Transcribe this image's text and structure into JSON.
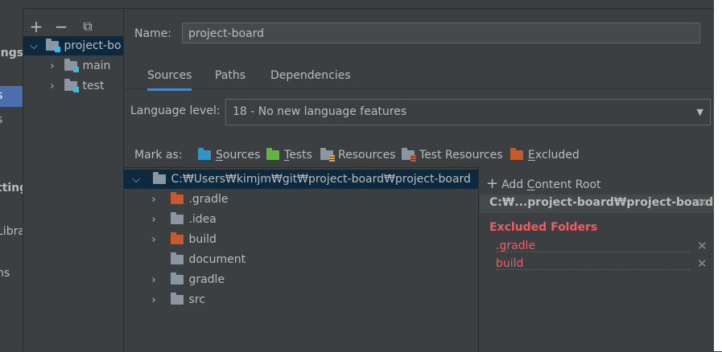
{
  "sidebar_fragments": [
    {
      "text": "ings",
      "bold": true
    },
    {
      "text": "s",
      "bold": false
    },
    {
      "text": "s",
      "bold": false
    },
    {
      "text": "tting",
      "bold": true
    },
    {
      "text": "Libra",
      "bold": false
    },
    {
      "text": "ns",
      "bold": false
    }
  ],
  "toolbar": {
    "add_icon": "+",
    "remove_icon": "−",
    "copy_icon": "⧉"
  },
  "module_tree": {
    "root": {
      "label": "project-bo",
      "icon": "module-folder-icon"
    },
    "children": [
      {
        "label": "main",
        "icon": "module-folder-icon"
      },
      {
        "label": "test",
        "icon": "module-folder-icon"
      }
    ]
  },
  "name_field": {
    "label": "Name:",
    "value": "project-board"
  },
  "tabs": [
    {
      "label": "Sources",
      "active": true
    },
    {
      "label": "Paths",
      "active": false
    },
    {
      "label": "Dependencies",
      "active": false
    }
  ],
  "language_level": {
    "label": "Language level:",
    "value": "18 - No new language features"
  },
  "mark_as": {
    "label": "Mark as:",
    "items": [
      {
        "label": "Sources",
        "mnemonic": "S",
        "rest": "ources",
        "icon": "sources-folder-icon",
        "color": "#3592c4"
      },
      {
        "label": "Tests",
        "mnemonic": "T",
        "rest": "ests",
        "icon": "tests-folder-icon",
        "color": "#62b543"
      },
      {
        "label": "Resources",
        "mnemonic": "",
        "rest": "Resources",
        "icon": "resources-folder-icon",
        "color": "#8c96a0"
      },
      {
        "label": "Test Resources",
        "mnemonic": "",
        "rest": "Test Resources",
        "icon": "test-resources-folder-icon",
        "color": "#8c96a0"
      },
      {
        "label": "Excluded",
        "mnemonic": "E",
        "rest": "xcluded",
        "icon": "excluded-folder-icon",
        "color": "#c75a2c"
      }
    ]
  },
  "content_tree": {
    "root": {
      "label": "C:₩Users₩kimjm₩git₩project-board₩project-board",
      "expanded": true
    },
    "items": [
      {
        "label": ".gradle",
        "expandable": true,
        "kind": "excluded"
      },
      {
        "label": ".idea",
        "expandable": true,
        "kind": "normal"
      },
      {
        "label": "build",
        "expandable": true,
        "kind": "excluded"
      },
      {
        "label": "document",
        "expandable": false,
        "kind": "normal"
      },
      {
        "label": "gradle",
        "expandable": true,
        "kind": "normal"
      },
      {
        "label": "src",
        "expandable": true,
        "kind": "normal"
      }
    ]
  },
  "content_root_panel": {
    "add_label_pre": "Add ",
    "add_mnemonic": "C",
    "add_label_post": "ontent Root",
    "root_path": "C:₩...project-board₩project-board",
    "excluded_title": "Excluded Folders",
    "excluded": [
      ".gradle",
      "build"
    ]
  },
  "colors": {
    "selection": "#0d293e",
    "excluded_red": "#f15c62",
    "tab_underline": "#4a88c7"
  }
}
